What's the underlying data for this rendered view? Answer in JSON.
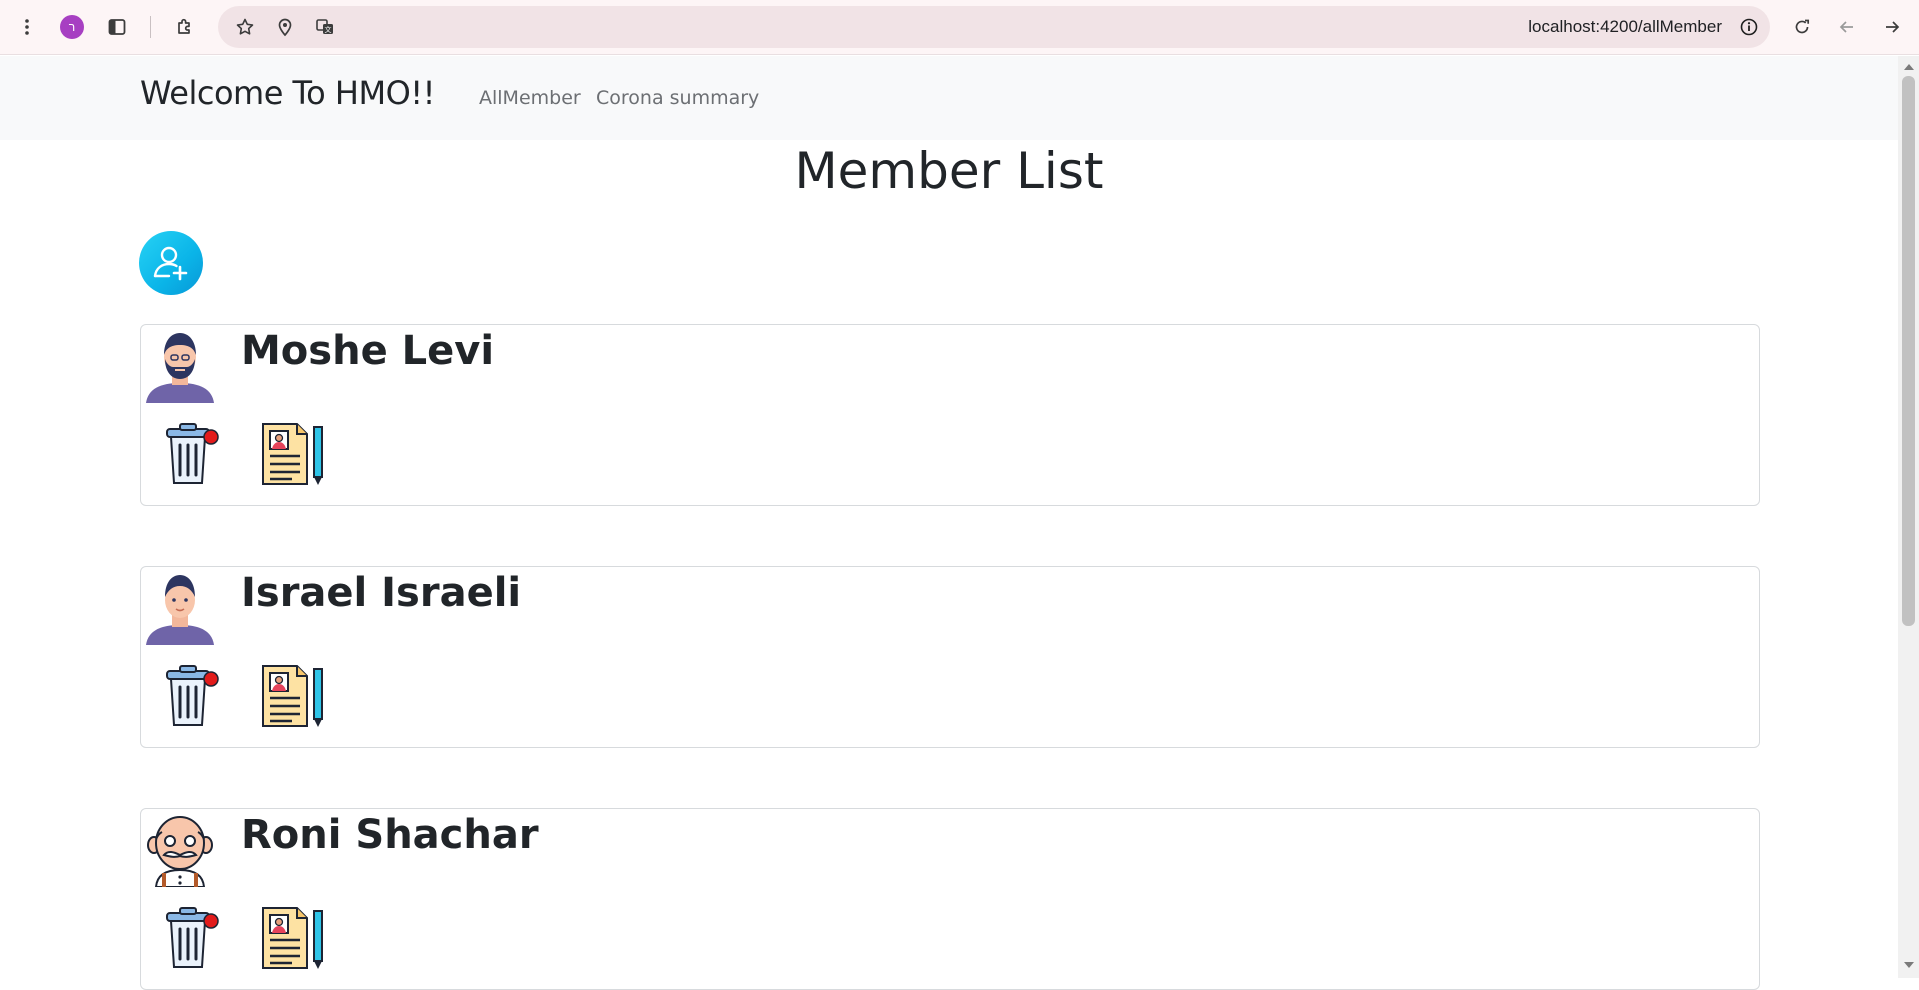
{
  "browser": {
    "url": "localhost:4200/allMember",
    "profile_initial": "ר",
    "icons": {
      "menu": "kebab-menu-icon",
      "sidebar": "side-panel-icon",
      "extensions": "puzzle-icon",
      "bookmark": "star-icon",
      "location": "location-pin-icon",
      "translate": "translate-icon",
      "site_info": "info-icon",
      "reload": "reload-icon",
      "back": "arrow-left-icon",
      "forward": "arrow-right-icon"
    }
  },
  "navbar": {
    "brand": "Welcome To HMO!!",
    "links": [
      "AllMember",
      "Corona summary"
    ]
  },
  "main": {
    "title": "Member List",
    "add_icon": "add-user-icon",
    "members": [
      {
        "name": "Moshe Levi",
        "avatar": "bearded-man-avatar-icon"
      },
      {
        "name": "Israel Israeli",
        "avatar": "young-man-avatar-icon"
      },
      {
        "name": "Roni Shachar",
        "avatar": "old-man-avatar-icon"
      }
    ]
  },
  "colors": {
    "navbar_bg": "#f8f9fa",
    "add_button": "#0ab4e8",
    "card_border": "#d7dadd",
    "text": "#212529",
    "link": "#6c6f73"
  }
}
